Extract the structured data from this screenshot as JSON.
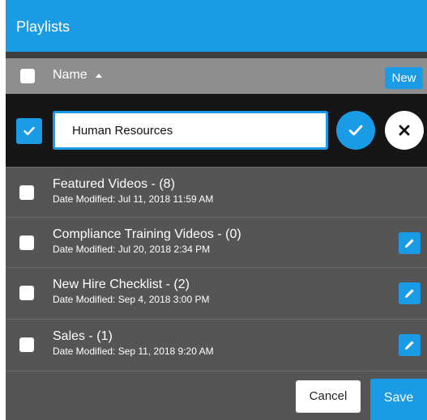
{
  "dialog": {
    "title": "Playlists",
    "accent_color": "#1a9be6"
  },
  "header": {
    "column_name": "Name",
    "sort_direction": "ascending",
    "new_label": "New"
  },
  "edit_row": {
    "checked": true,
    "input_value": "Human Resources",
    "confirm_icon": "check-icon",
    "cancel_icon": "close-icon"
  },
  "playlists": [
    {
      "title": "Featured Videos - (8)",
      "date": "Date Modified: Jul 11, 2018 11:59 AM",
      "editable": false
    },
    {
      "title": "Compliance Training Videos - (0)",
      "date": "Date Modified: Jul 20, 2018 2:34 PM",
      "editable": true
    },
    {
      "title": "New Hire Checklist - (2)",
      "date": "Date Modified: Sep 4, 2018 3:00 PM",
      "editable": true
    },
    {
      "title": "Sales - (1)",
      "date": "Date Modified: Sep 11, 2018 9:20 AM",
      "editable": true
    }
  ],
  "footer": {
    "cancel_label": "Cancel",
    "save_label": "Save"
  }
}
